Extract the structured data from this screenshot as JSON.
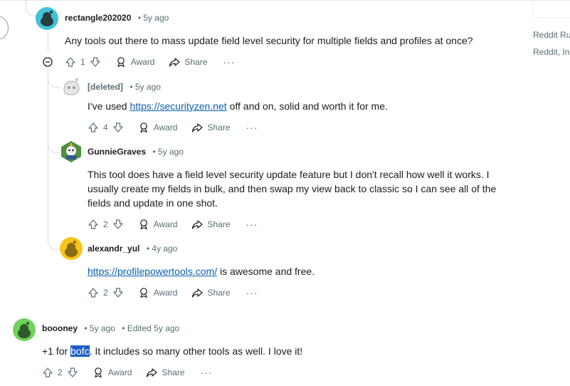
{
  "sidebar": {
    "link_1": "Reddit Ru",
    "link_2": "Reddit, Inc"
  },
  "comments": [
    {
      "author": "rectangle202020",
      "time": "5y ago",
      "body": "Any tools out there to mass update field level security for multiple fields and profiles at once?",
      "votes": "1",
      "award": "Award",
      "share": "Share",
      "more": "···",
      "avatar_color": "#3ec3d9"
    },
    {
      "author": "[deleted]",
      "time": "5y ago",
      "body_link": "https://securityzen.net",
      "body_rest": " off and on, solid and worth it for me.",
      "body_prefix": "I've used ",
      "votes": "4",
      "award": "Award",
      "share": "Share",
      "more": "···"
    },
    {
      "author": "GunnieGraves",
      "time": "5y ago",
      "body_line1": "This tool does have a field level security update feature but I don't recall how well it works. I",
      "body_line2": "usually create my fields in bulk, and then swap my view back to classic so I can see all of the",
      "body_line3": "fields and update in one shot.",
      "votes": "2",
      "award": "Award",
      "share": "Share",
      "more": "···",
      "avatar_color": "#4f8f3e"
    },
    {
      "author": "alexandr_yul",
      "time": "4y ago",
      "body_link": "https://profilepowertools.com/",
      "body_rest": " is awesome and free.",
      "votes": "2",
      "award": "Award",
      "share": "Share",
      "more": "···",
      "avatar_color": "#f5c518"
    },
    {
      "author": "boooney",
      "time": "5y ago",
      "edited": "Edited 5y ago",
      "body_prefix": "+1 for ",
      "body_selected": "bofc",
      "body_rest": ". It includes so many other tools as well. I love it!",
      "votes": "2",
      "award": "Award",
      "share": "Share",
      "more": "···",
      "avatar_color": "#6fd25a"
    }
  ],
  "separator": "•"
}
